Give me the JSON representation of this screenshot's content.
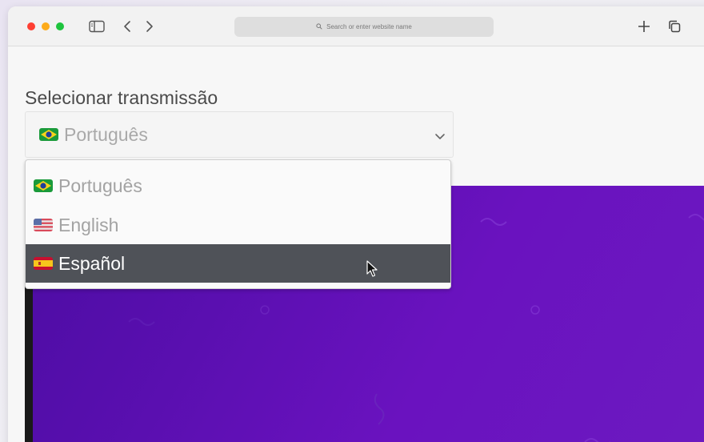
{
  "browser": {
    "address_placeholder": "Search or enter website name",
    "icons": [
      "sidebar-icon",
      "back-icon",
      "forward-icon",
      "search-icon",
      "new-tab-icon",
      "tabs-overview-icon"
    ]
  },
  "page": {
    "title": "Selecionar transmissão"
  },
  "language_select": {
    "current_value": "Português",
    "current_flag": "brazil-flag-icon",
    "options": [
      {
        "label": "Português",
        "flag": "brazil-flag-icon",
        "selected": false
      },
      {
        "label": "English",
        "flag": "usa-flag-icon",
        "selected": false
      },
      {
        "label": "Español",
        "flag": "spain-flag-icon",
        "selected": true
      }
    ]
  },
  "colors": {
    "video_background": "#5a0fb0",
    "selected_option_background": "#4f5258",
    "traffic_red": "#fe3f33",
    "traffic_yellow": "#fdab1b",
    "traffic_green": "#1ec43e"
  }
}
